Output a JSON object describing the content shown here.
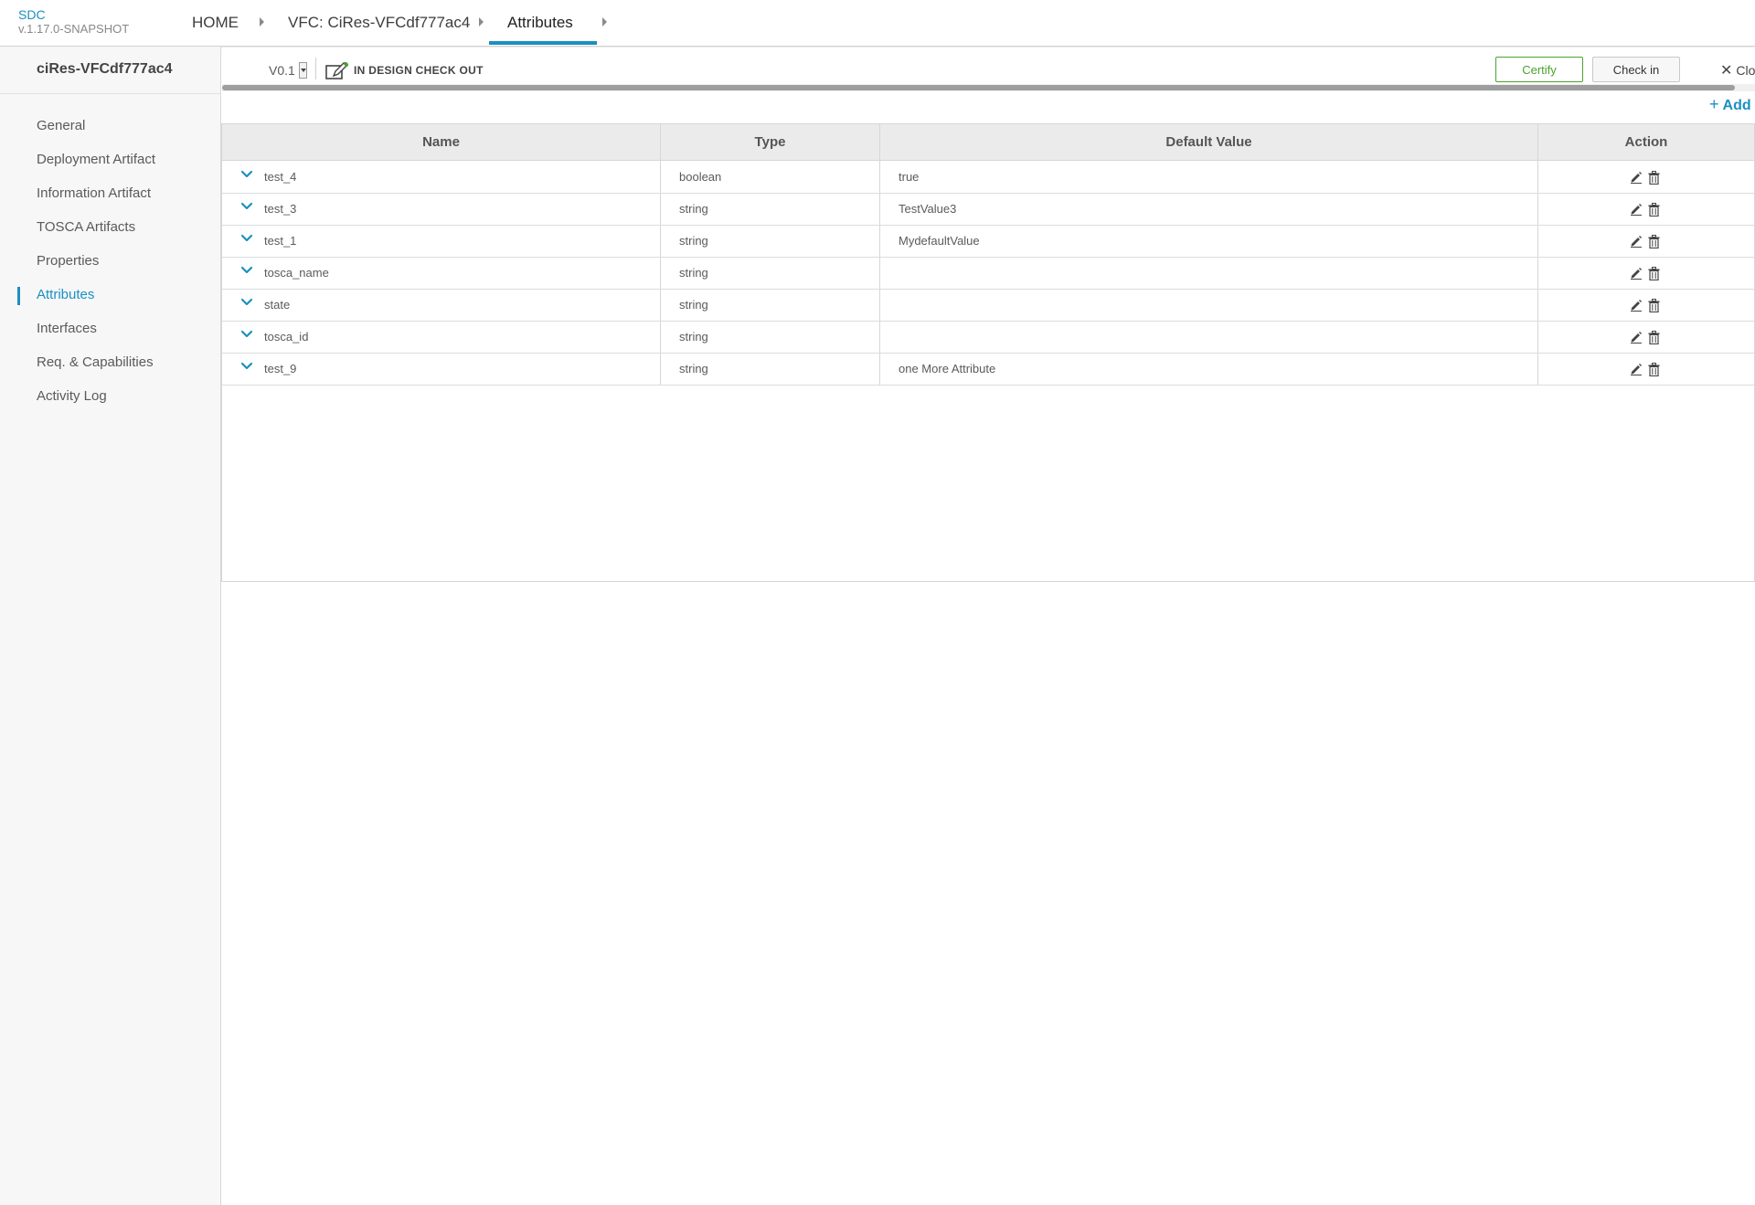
{
  "header": {
    "app_name": "SDC",
    "app_version": "v.1.17.0-SNAPSHOT",
    "breadcrumbs": [
      "HOME",
      "VFC: CiRes-VFCdf777ac4",
      "Attributes"
    ]
  },
  "sidebar": {
    "title": "ciRes-VFCdf777ac4",
    "items": [
      {
        "label": "General"
      },
      {
        "label": "Deployment Artifact"
      },
      {
        "label": "Information Artifact"
      },
      {
        "label": "TOSCA Artifacts"
      },
      {
        "label": "Properties"
      },
      {
        "label": "Attributes",
        "active": true
      },
      {
        "label": "Interfaces"
      },
      {
        "label": "Req. & Capabilities"
      },
      {
        "label": "Activity Log"
      }
    ]
  },
  "toolbar": {
    "version": "V0.1",
    "status": "IN DESIGN CHECK OUT",
    "certify_label": "Certify",
    "checkin_label": "Check in",
    "close_label": "Clo"
  },
  "add_label": "Add",
  "table": {
    "columns": [
      "Name",
      "Type",
      "Default Value",
      "Action"
    ],
    "rows": [
      {
        "name": "test_4",
        "type": "boolean",
        "default": "true"
      },
      {
        "name": "test_3",
        "type": "string",
        "default": "TestValue3"
      },
      {
        "name": "test_1",
        "type": "string",
        "default": "MydefaultValue"
      },
      {
        "name": "tosca_name",
        "type": "string",
        "default": ""
      },
      {
        "name": "state",
        "type": "string",
        "default": ""
      },
      {
        "name": "tosca_id",
        "type": "string",
        "default": ""
      },
      {
        "name": "test_9",
        "type": "string",
        "default": "one More Attribute"
      }
    ]
  },
  "colors": {
    "accent": "#1b8fc2",
    "certify": "#4aa32e"
  }
}
